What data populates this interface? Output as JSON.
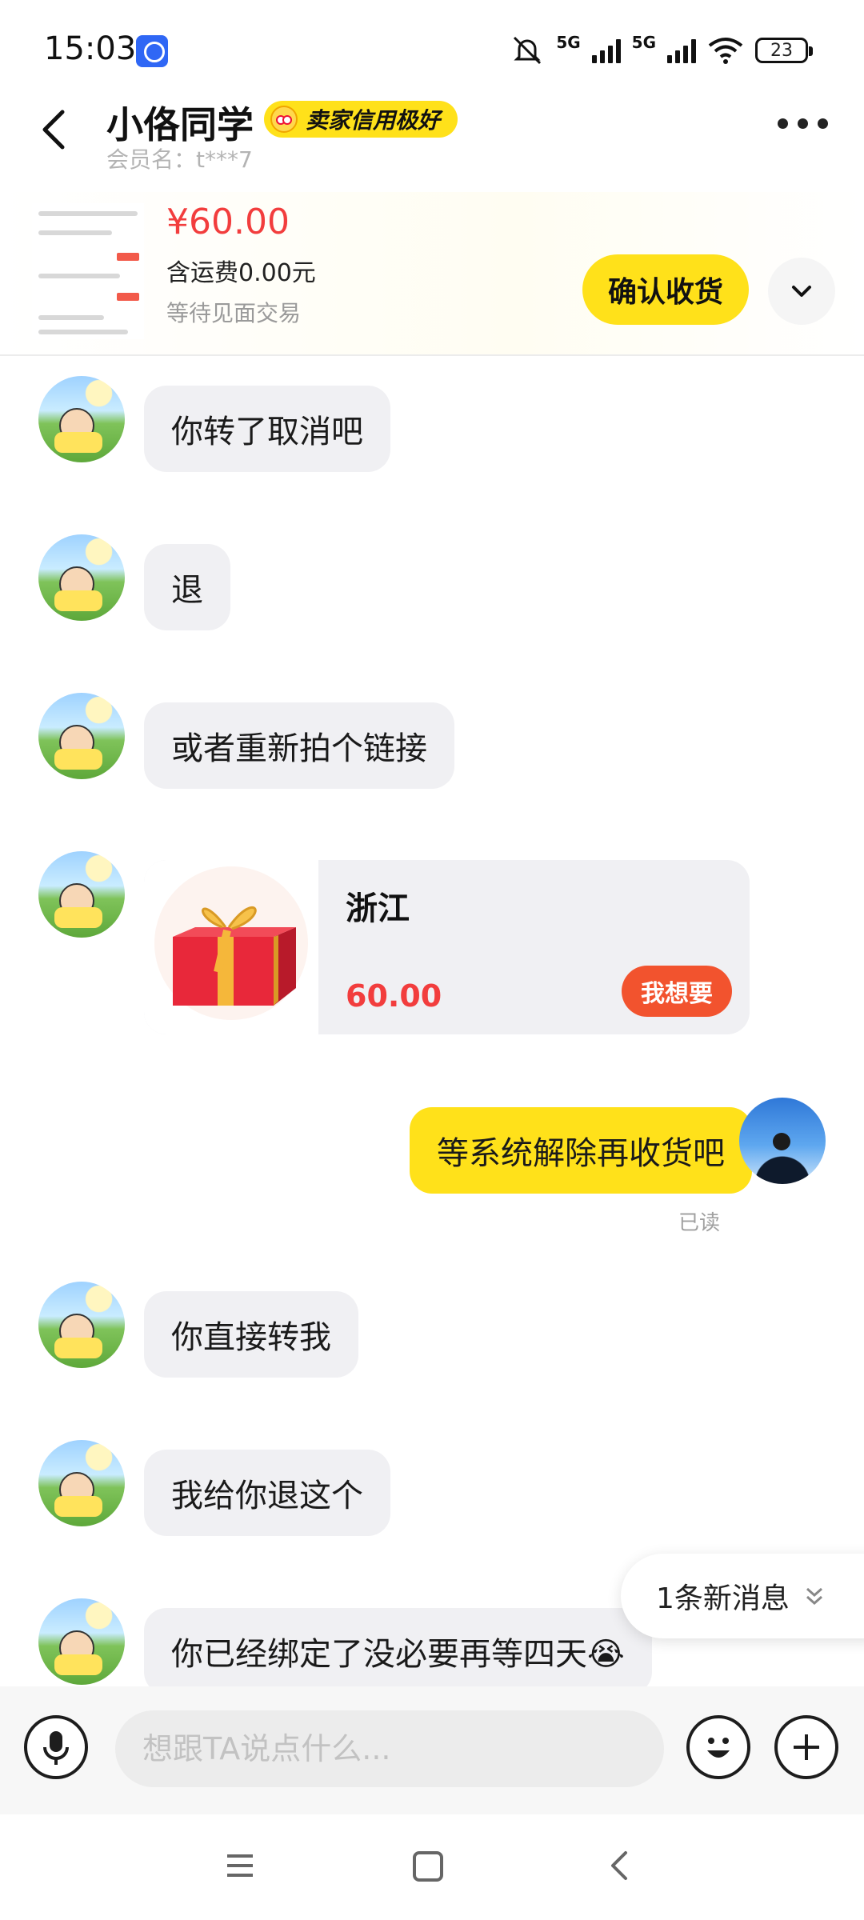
{
  "status_bar": {
    "time": "15:03",
    "network1": "5G",
    "network2": "5G",
    "battery": "23"
  },
  "header": {
    "title": "小佫同学",
    "badge": "卖家信用极好",
    "member_label": "会员名：t***7"
  },
  "order": {
    "price": "¥60.00",
    "shipping": "含运费0.00元",
    "status": "等待见面交易",
    "confirm_label": "确认收货"
  },
  "messages": [
    {
      "side": "left",
      "text": "你转了取消吧"
    },
    {
      "side": "left",
      "text": "退"
    },
    {
      "side": "left",
      "text": "或者重新拍个链接"
    },
    {
      "side": "left",
      "type": "product",
      "title": "浙江",
      "price": "60.00",
      "action": "我想要"
    },
    {
      "side": "right",
      "text": "等系统解除再收货吧",
      "status": "已读"
    },
    {
      "side": "left",
      "text": "你直接转我"
    },
    {
      "side": "left",
      "text": "我给你退这个"
    },
    {
      "side": "left",
      "text": "你已经绑定了没必要再等四天😭"
    }
  ],
  "new_message_tip": "1条新消息",
  "input": {
    "placeholder": "想跟TA说点什么..."
  },
  "colors": {
    "accent_yellow": "#ffe11a",
    "price_red": "#f23d3d",
    "button_orange": "#f2532e"
  },
  "icons": [
    "back-arrow-icon",
    "more-icon",
    "chevron-down-icon",
    "mic-icon",
    "emoji-icon",
    "plus-icon",
    "menu-icon",
    "home-icon",
    "nav-back-icon"
  ]
}
